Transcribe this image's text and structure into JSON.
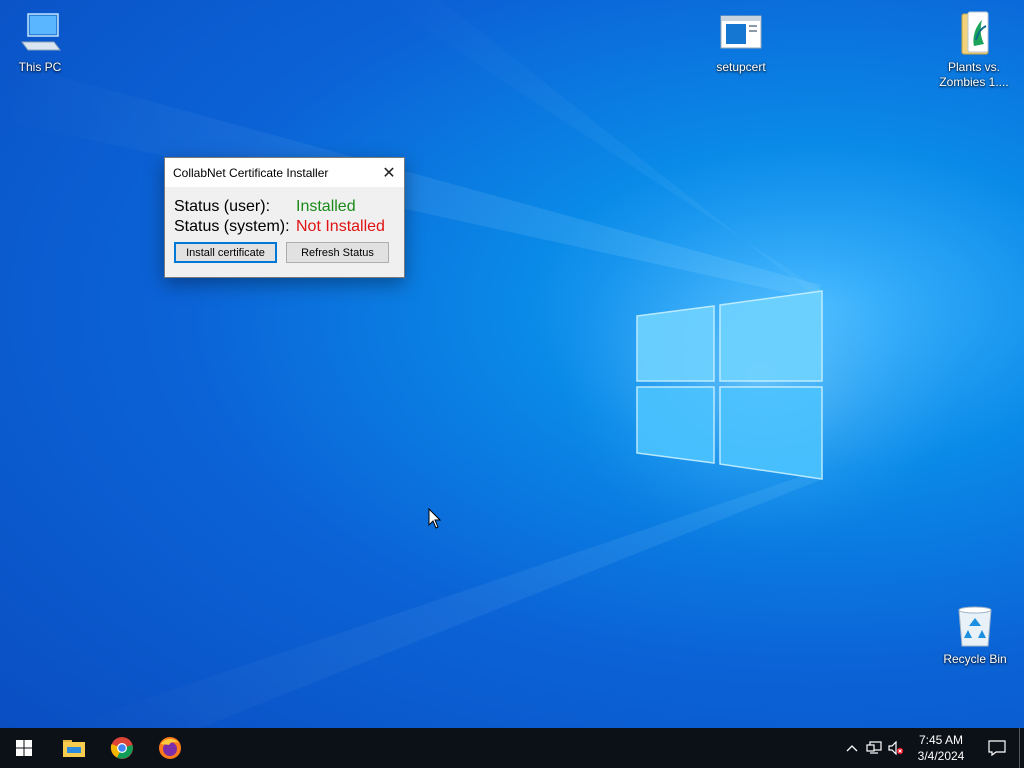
{
  "desktop": {
    "icons": [
      {
        "label": "This PC",
        "icon": "computer-icon"
      },
      {
        "label": "setupcert",
        "icon": "application-window-icon"
      },
      {
        "label": "Plants vs. Zombies 1....",
        "icon": "folder-icon"
      },
      {
        "label": "Recycle Bin",
        "icon": "recycle-bin-icon"
      }
    ]
  },
  "dialog": {
    "title": "CollabNet Certificate Installer",
    "close_label": "✕",
    "user_status_label": "Status (user):",
    "user_status_value": "Installed",
    "system_status_label": "Status (system):",
    "system_status_value": "Not Installed",
    "install_button": "Install certificate",
    "refresh_button": "Refresh Status",
    "colors": {
      "installed": "#1a8a1a",
      "not_installed": "#e01212",
      "accent": "#0078d7"
    }
  },
  "taskbar": {
    "apps": [
      "start-icon",
      "file-explorer-icon",
      "chrome-icon",
      "firefox-icon"
    ],
    "tray": {
      "icons": [
        "chevron-up-icon",
        "network-icon",
        "volume-muted-icon"
      ],
      "time": "7:45 AM",
      "date": "3/4/2024",
      "notification_icon": "notification-icon"
    }
  }
}
